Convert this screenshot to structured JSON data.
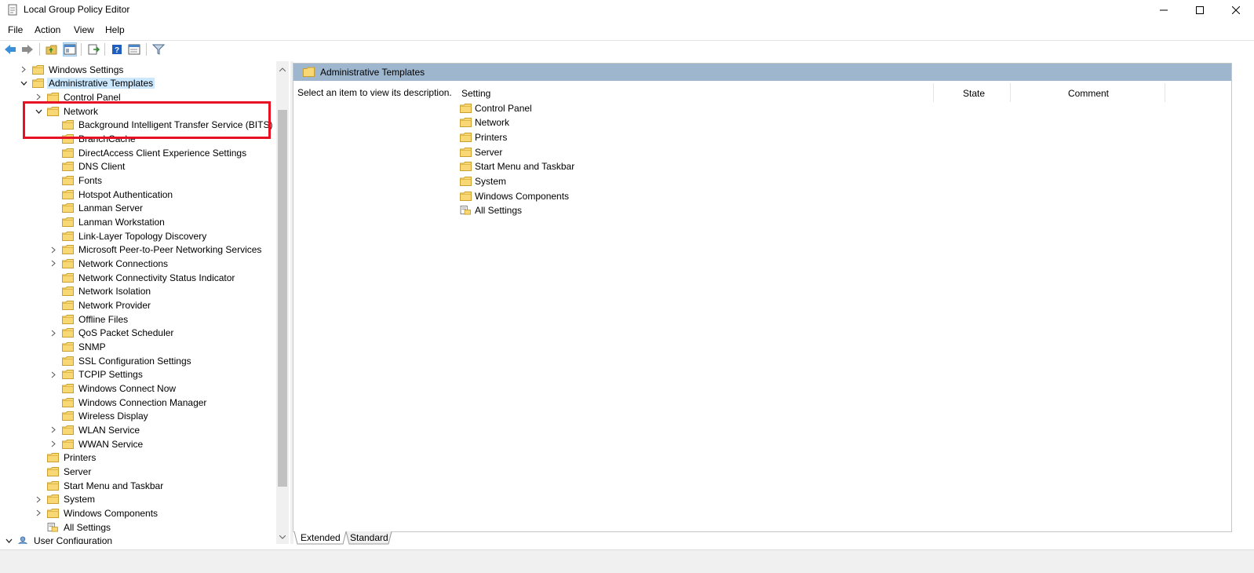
{
  "window": {
    "title": "Local Group Policy Editor"
  },
  "menu": [
    "File",
    "Action",
    "View",
    "Help"
  ],
  "tree": [
    {
      "label": "Windows Settings",
      "chev": ">",
      "folder": true
    },
    {
      "label": "Administrative Templates",
      "chev": "v",
      "folder": true,
      "selected": true
    },
    {
      "label": "Control Panel",
      "chev": ">",
      "folder": true
    },
    {
      "label": "Network",
      "chev": "v",
      "folder": true
    },
    {
      "label": "Background Intelligent Transfer Service (BITS)",
      "folder": true
    },
    {
      "label": "BranchCache",
      "folder": true
    },
    {
      "label": "DirectAccess Client Experience Settings",
      "folder": true
    },
    {
      "label": "DNS Client",
      "folder": true
    },
    {
      "label": "Fonts",
      "folder": true
    },
    {
      "label": "Hotspot Authentication",
      "folder": true
    },
    {
      "label": "Lanman Server",
      "folder": true
    },
    {
      "label": "Lanman Workstation",
      "folder": true
    },
    {
      "label": "Link-Layer Topology Discovery",
      "folder": true
    },
    {
      "label": "Microsoft Peer-to-Peer Networking Services",
      "chev": ">",
      "folder": true
    },
    {
      "label": "Network Connections",
      "chev": ">",
      "folder": true
    },
    {
      "label": "Network Connectivity Status Indicator",
      "folder": true
    },
    {
      "label": "Network Isolation",
      "folder": true
    },
    {
      "label": "Network Provider",
      "folder": true
    },
    {
      "label": "Offline Files",
      "folder": true
    },
    {
      "label": "QoS Packet Scheduler",
      "chev": ">",
      "folder": true
    },
    {
      "label": "SNMP",
      "folder": true
    },
    {
      "label": "SSL Configuration Settings",
      "folder": true
    },
    {
      "label": "TCPIP Settings",
      "chev": ">",
      "folder": true
    },
    {
      "label": "Windows Connect Now",
      "folder": true
    },
    {
      "label": "Windows Connection Manager",
      "folder": true
    },
    {
      "label": "Wireless Display",
      "folder": true
    },
    {
      "label": "WLAN Service",
      "chev": ">",
      "folder": true
    },
    {
      "label": "WWAN Service",
      "chev": ">",
      "folder": true
    },
    {
      "label": "Printers",
      "folder": true
    },
    {
      "label": "Server",
      "folder": true
    },
    {
      "label": "Start Menu and Taskbar",
      "folder": true
    },
    {
      "label": "System",
      "chev": ">",
      "folder": true
    },
    {
      "label": "Windows Components",
      "chev": ">",
      "folder": true
    },
    {
      "label": "All Settings",
      "folder": false
    },
    {
      "label": "User Configuration",
      "chev": "v",
      "folder": false
    }
  ],
  "right": {
    "header": "Administrative Templates",
    "description": "Select an item to view its description.",
    "columns": {
      "setting": "Setting",
      "state": "State",
      "comment": "Comment"
    },
    "items": [
      {
        "label": "Control Panel",
        "folder": true
      },
      {
        "label": "Network",
        "folder": true
      },
      {
        "label": "Printers",
        "folder": true
      },
      {
        "label": "Server",
        "folder": true
      },
      {
        "label": "Start Menu and Taskbar",
        "folder": true
      },
      {
        "label": "System",
        "folder": true
      },
      {
        "label": "Windows Components",
        "folder": true
      },
      {
        "label": "All Settings",
        "folder": false
      }
    ]
  },
  "tabs": [
    "Extended",
    "Standard"
  ]
}
